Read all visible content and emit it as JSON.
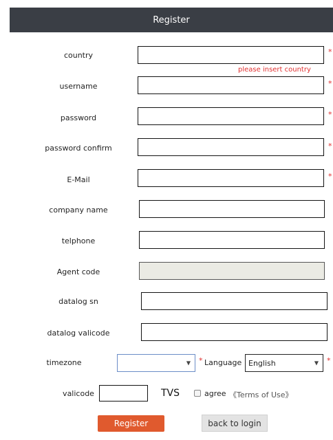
{
  "header": {
    "title": "Register"
  },
  "fields": {
    "country": {
      "label": "country",
      "error": "please insert country"
    },
    "username": {
      "label": "username"
    },
    "password": {
      "label": "password"
    },
    "password_confirm": {
      "label": "password confirm"
    },
    "email": {
      "label": "E-Mail"
    },
    "company_name": {
      "label": "company name"
    },
    "telphone": {
      "label": "telphone"
    },
    "agent_code": {
      "label": "Agent code"
    },
    "datalog_sn": {
      "label": "datalog sn"
    },
    "datalog_valicode": {
      "label": "datalog valicode"
    },
    "timezone": {
      "label": "timezone",
      "value": ""
    },
    "language": {
      "label": "Language",
      "value": "English"
    },
    "valicode": {
      "label": "valicode",
      "captcha": "TVS"
    },
    "agree": {
      "label": "agree",
      "terms": "《Terms of Use》"
    }
  },
  "required_mark": "*",
  "buttons": {
    "register": "Register",
    "back": "back to login"
  },
  "colors": {
    "header_bg": "#3a3e45",
    "accent": "#e05a2e",
    "error": "#e03030"
  }
}
